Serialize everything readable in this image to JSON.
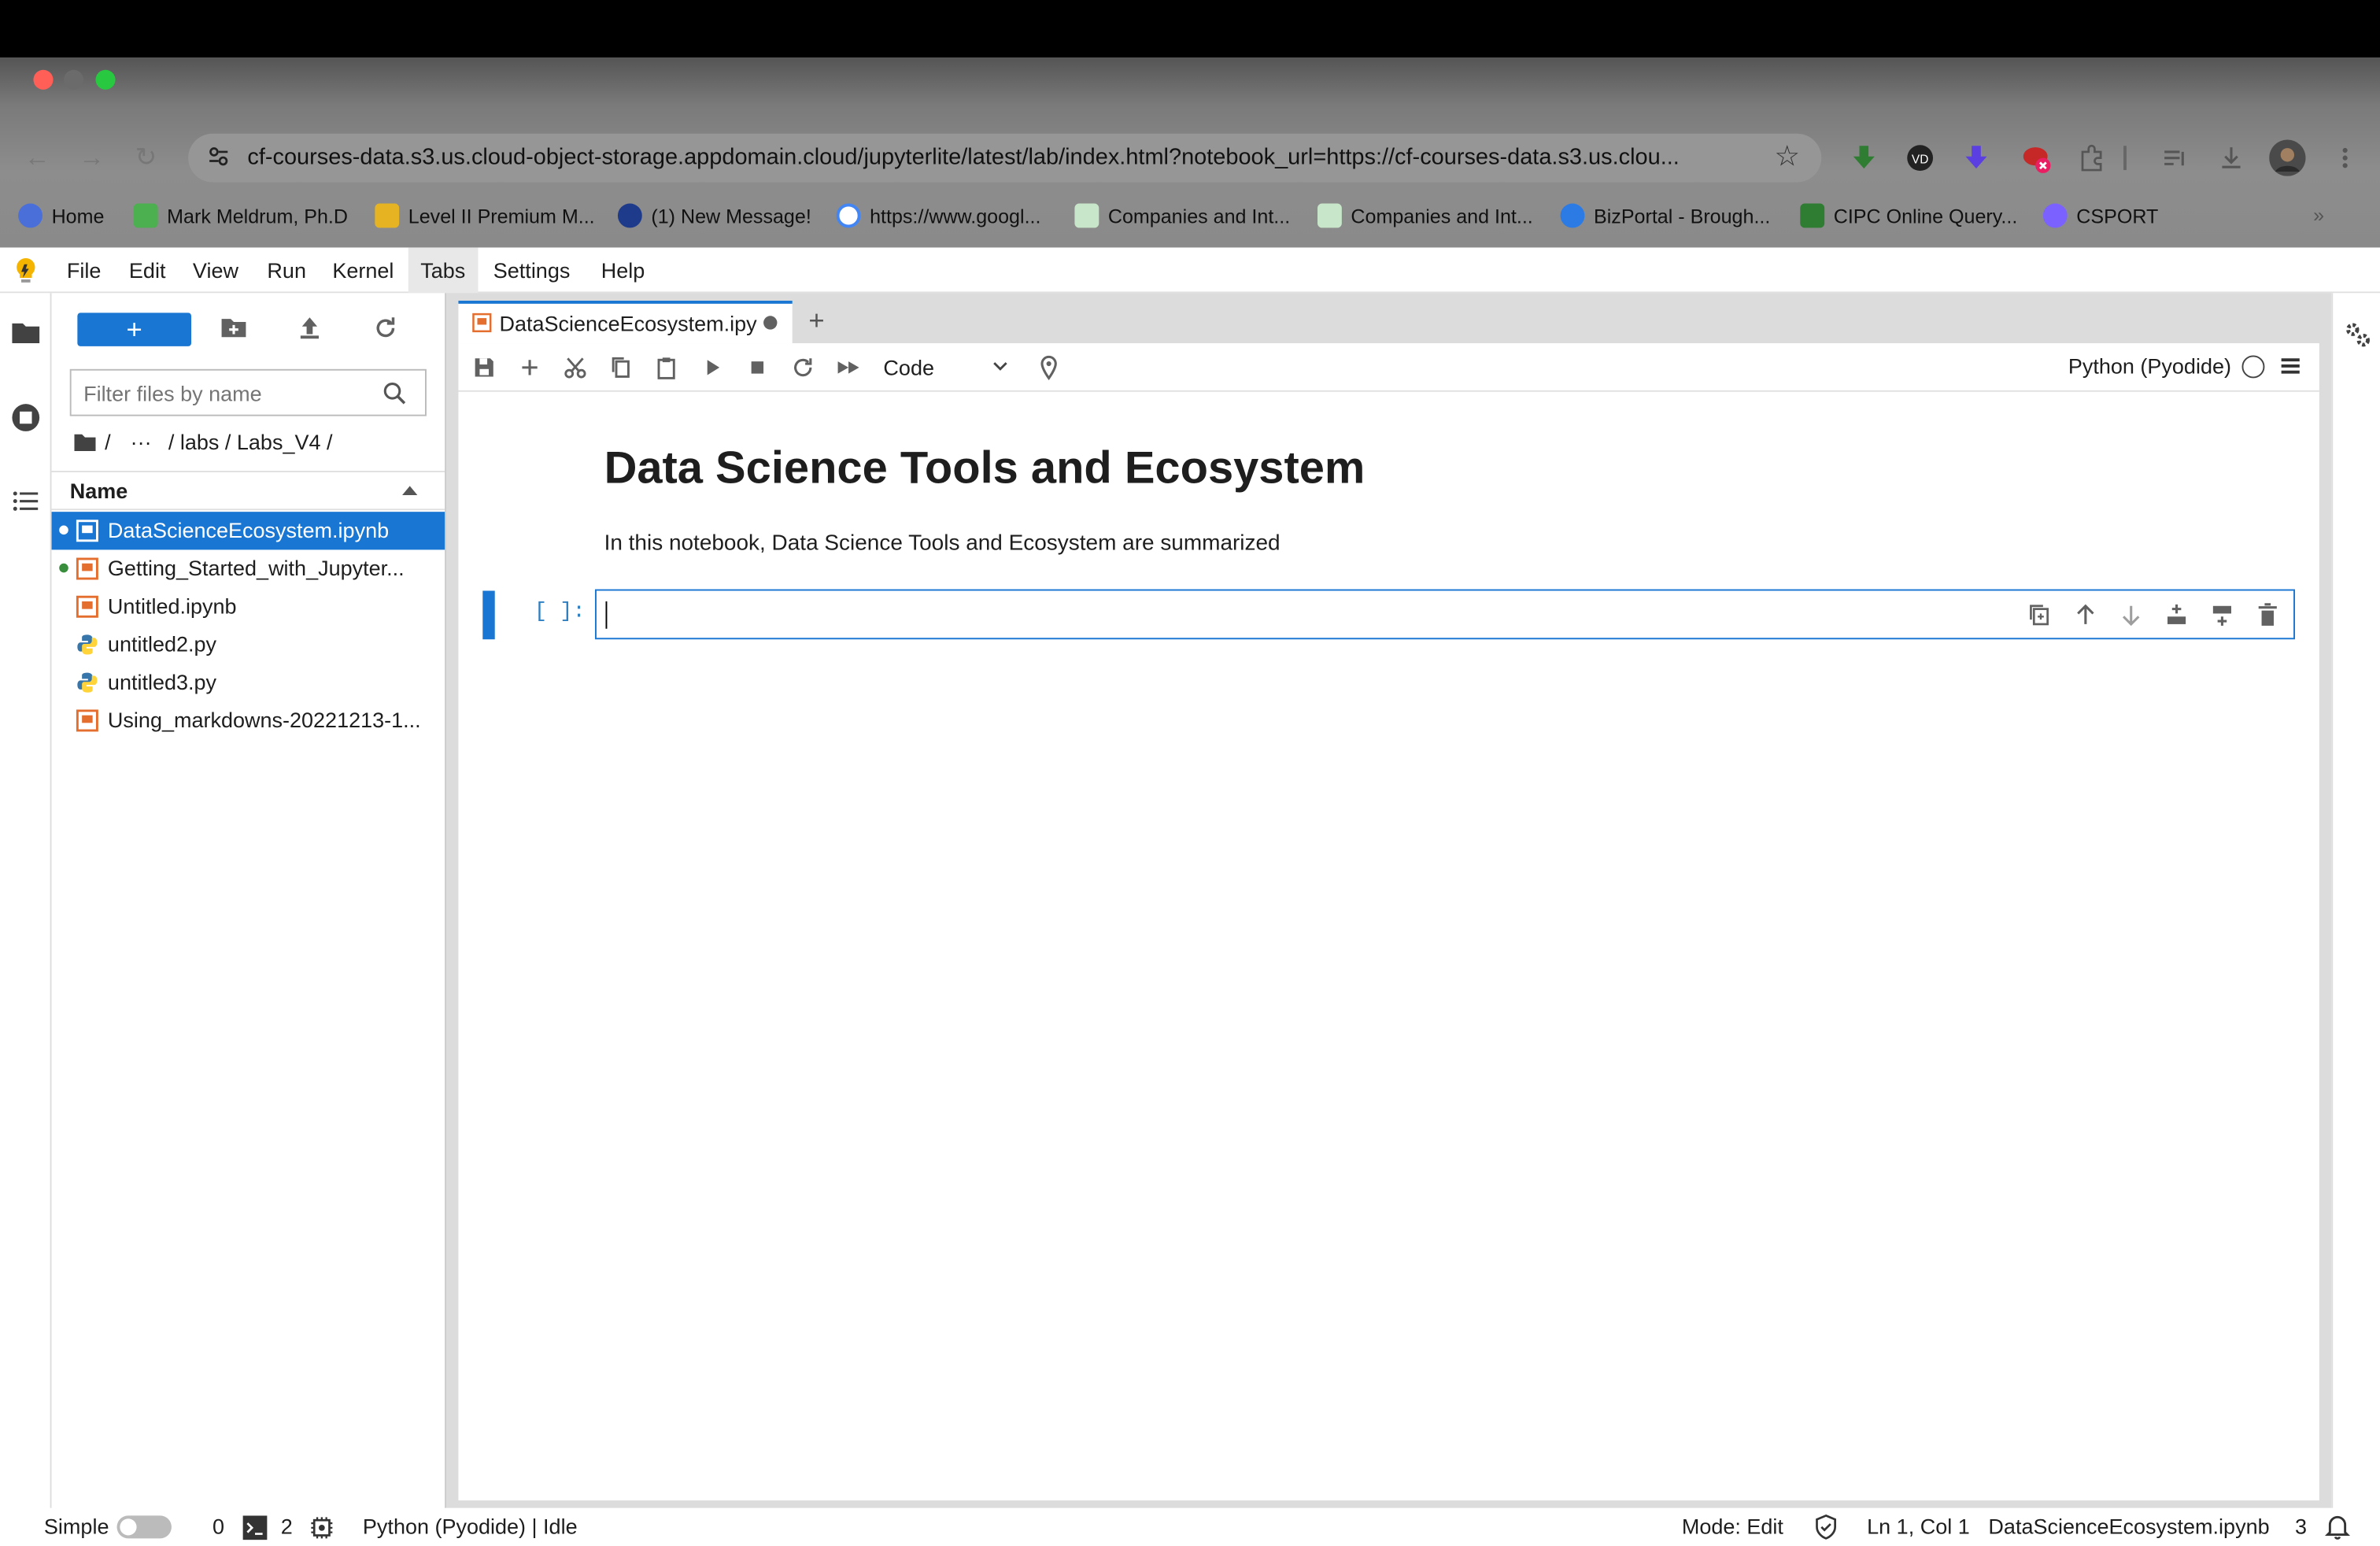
{
  "browser": {
    "url": "cf-courses-data.s3.us.cloud-object-storage.appdomain.cloud/jupyterlite/latest/lab/index.html?notebook_url=https://cf-courses-data.s3.us.clou...",
    "bookmarks": [
      {
        "label": "Home",
        "icon": "globe-icon",
        "color": "#4a6fd8"
      },
      {
        "label": "Mark Meldrum, Ph.D",
        "icon": "check-icon",
        "color": "#4caf50"
      },
      {
        "label": "Level II Premium M...",
        "icon": "folder-icon",
        "color": "#e6b422"
      },
      {
        "label": "(1) New Message!",
        "icon": "live-icon",
        "color": "#1e3a8a"
      },
      {
        "label": "https://www.googl...",
        "icon": "google-icon",
        "color": "#ffffff"
      },
      {
        "label": "Companies and Int...",
        "icon": "cipc-icon",
        "color": "#c8e6c9"
      },
      {
        "label": "Companies and Int...",
        "icon": "cipc-icon",
        "color": "#c8e6c9"
      },
      {
        "label": "BizPortal - Brough...",
        "icon": "bizportal-icon",
        "color": "#2c7be5"
      },
      {
        "label": "CIPC Online Query...",
        "icon": "b-icon",
        "color": "#2e7d32"
      },
      {
        "label": "CSPORT",
        "icon": "csport-icon",
        "color": "#7b61ff"
      }
    ]
  },
  "menubar": {
    "items": [
      "File",
      "Edit",
      "View",
      "Run",
      "Kernel",
      "Tabs",
      "Settings",
      "Help"
    ],
    "active": "Tabs"
  },
  "filebrowser": {
    "new_label": "+",
    "filter_placeholder": "Filter files by name",
    "breadcrumb": {
      "sep": "/",
      "ellipsis": "···",
      "path": "/ labs / Labs_V4 /"
    },
    "column_header": "Name",
    "files": [
      {
        "name": "DataScienceEcosystem.ipynb",
        "type": "notebook",
        "running": true,
        "selected": true
      },
      {
        "name": "Getting_Started_with_Jupyter...",
        "type": "notebook",
        "running": true,
        "selected": false
      },
      {
        "name": "Untitled.ipynb",
        "type": "notebook",
        "running": false,
        "selected": false
      },
      {
        "name": "untitled2.py",
        "type": "python",
        "running": false,
        "selected": false
      },
      {
        "name": "untitled3.py",
        "type": "python",
        "running": false,
        "selected": false
      },
      {
        "name": "Using_markdowns-20221213-1...",
        "type": "notebook",
        "running": false,
        "selected": false
      }
    ]
  },
  "notebook": {
    "tab_label": "DataScienceEcosystem.ipy",
    "new_tab": "+",
    "cell_type": "Code",
    "kernel": "Python (Pyodide)",
    "title": "Data Science Tools and Ecosystem",
    "intro": "In this notebook, Data Science Tools and Ecosystem are summarized",
    "prompt": "[ ]:"
  },
  "statusbar": {
    "mode_toggle_label": "Simple",
    "terminals": "0",
    "kernels": "2",
    "kernel_status": "Python (Pyodide) | Idle",
    "mode": "Mode: Edit",
    "position": "Ln 1, Col 1",
    "filename": "DataScienceEcosystem.ipynb",
    "notifications": "3"
  },
  "colors": {
    "accent": "#1976d2",
    "notebook_icon": "#e46e2e",
    "running_dot": "#388e3c"
  }
}
